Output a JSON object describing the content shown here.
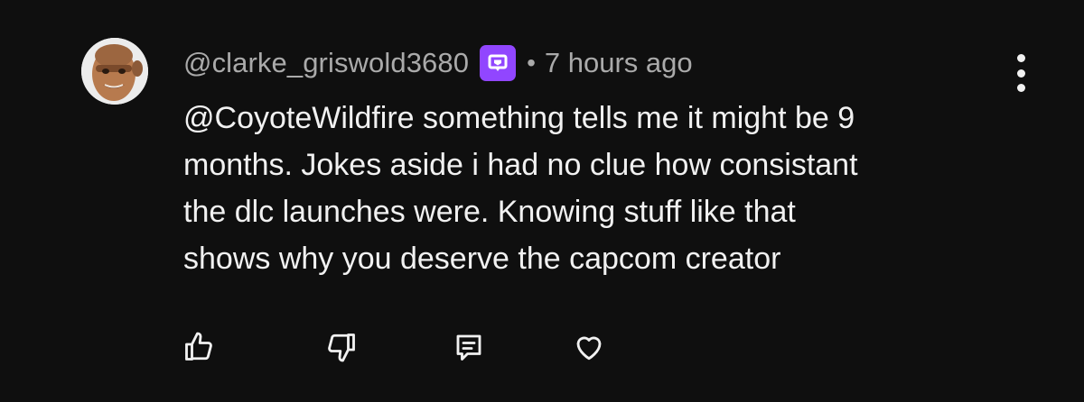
{
  "comment": {
    "author": "@clarke_griswold3680",
    "separator": "•",
    "timestamp": "7 hours ago",
    "body_lines": [
      "@CoyoteWildfire something tells me it might be 9",
      "months. Jokes aside i had no clue how consistant",
      "the dlc launches were. Knowing stuff like that",
      "shows why you deserve the capcom creator"
    ],
    "badge_color": "#9146ff",
    "icons": {
      "badge": "chat-bubble-badge-icon",
      "like": "thumbs-up-icon",
      "dislike": "thumbs-down-icon",
      "reply": "comment-icon",
      "heart": "heart-icon",
      "menu": "vertical-dots-icon"
    }
  }
}
